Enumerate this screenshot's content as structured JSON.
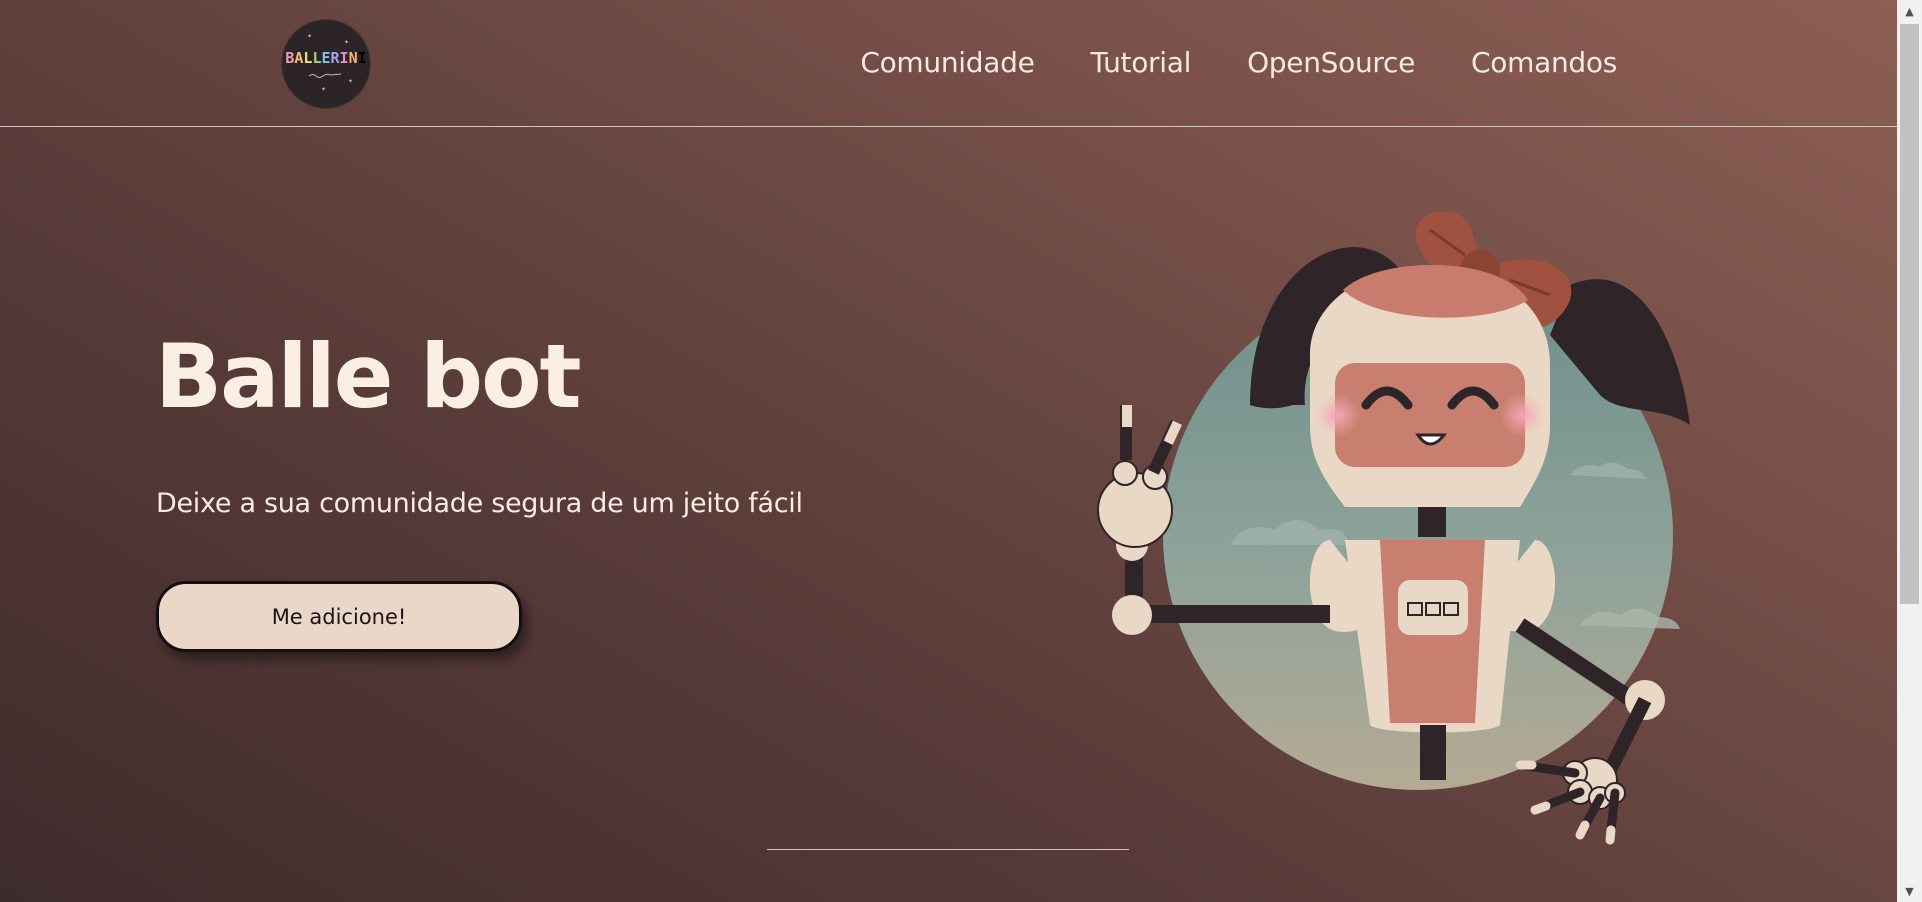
{
  "logo": {
    "text": "BALLERINI"
  },
  "nav": {
    "items": [
      {
        "label": "Comunidade"
      },
      {
        "label": "Tutorial"
      },
      {
        "label": "OpenSource"
      },
      {
        "label": "Comandos"
      }
    ]
  },
  "hero": {
    "title": "Balle bot",
    "subtitle": "Deixe a sua comunidade segura de um jeito fácil",
    "cta_label": "Me adicione!"
  },
  "illustration": {
    "name": "robot-girl-mascot"
  },
  "colors": {
    "background_dark": "#3e2b2c",
    "background_light": "#8c5e54",
    "text_light": "#fbeee4",
    "button_bg": "#ebd7c7"
  }
}
